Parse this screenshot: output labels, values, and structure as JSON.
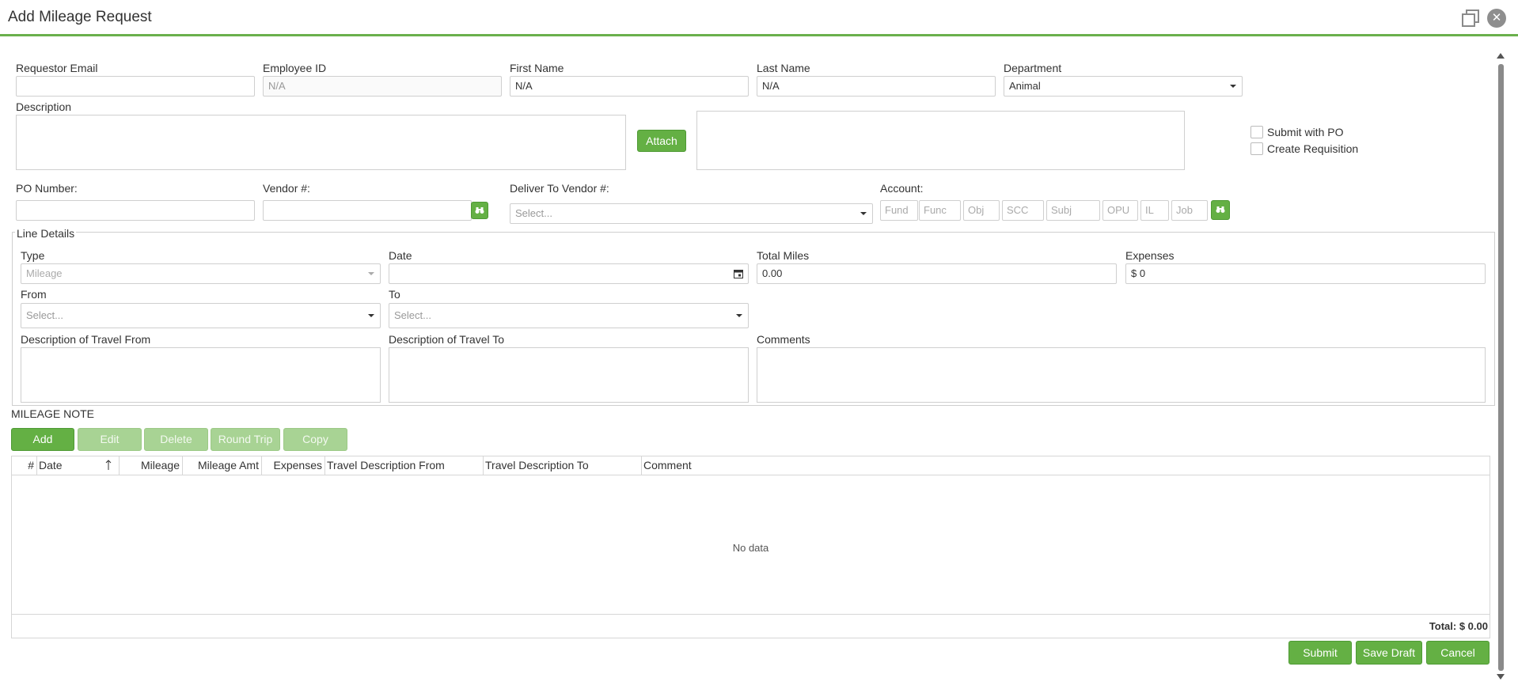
{
  "window": {
    "title": "Add Mileage Request"
  },
  "header": {
    "requestor_email": {
      "label": "Requestor Email",
      "value": ""
    },
    "employee_id": {
      "label": "Employee ID",
      "placeholder": "N/A",
      "value": ""
    },
    "first_name": {
      "label": "First Name",
      "value": "N/A"
    },
    "last_name": {
      "label": "Last Name",
      "value": "N/A"
    },
    "department": {
      "label": "Department",
      "value": "Animal"
    },
    "description": {
      "label": "Description"
    },
    "attach_label": "Attach",
    "submit_with_po": "Submit with PO",
    "create_requisition": "Create Requisition",
    "po_number": {
      "label": "PO Number:",
      "value": ""
    },
    "vendor": {
      "label": "Vendor #:",
      "value": ""
    },
    "deliver_to_vendor": {
      "label": "Deliver To Vendor #:",
      "placeholder": "Select..."
    },
    "account": {
      "label": "Account:",
      "segments": [
        "Fund",
        "Func",
        "Obj",
        "SCC",
        "Subj",
        "OPU",
        "IL",
        "Job"
      ]
    }
  },
  "line_details": {
    "legend": "Line Details",
    "type": {
      "label": "Type",
      "value": "Mileage"
    },
    "date": {
      "label": "Date",
      "value": ""
    },
    "total_miles": {
      "label": "Total Miles",
      "value": "0.00"
    },
    "expenses": {
      "label": "Expenses",
      "value": "$ 0"
    },
    "from": {
      "label": "From",
      "placeholder": "Select..."
    },
    "to": {
      "label": "To",
      "placeholder": "Select..."
    },
    "desc_from": {
      "label": "Description of Travel From"
    },
    "desc_to": {
      "label": "Description of Travel To"
    },
    "comments": {
      "label": "Comments"
    }
  },
  "mileage_note": "MILEAGE NOTE",
  "toolbar": {
    "add": "Add",
    "edit": "Edit",
    "delete": "Delete",
    "round_trip": "Round Trip",
    "copy": "Copy"
  },
  "grid": {
    "columns": [
      "#",
      "Date",
      "Mileage",
      "Mileage Amt",
      "Expenses",
      "Travel Description From",
      "Travel Description To",
      "Comment"
    ],
    "empty_text": "No data",
    "total": "Total: $ 0.00"
  },
  "footer": {
    "submit": "Submit",
    "save_draft": "Save Draft",
    "cancel": "Cancel"
  },
  "colors": {
    "accent": "#64b044",
    "accent_disabled": "#a8d394",
    "title_rule": "#6ab04c"
  }
}
